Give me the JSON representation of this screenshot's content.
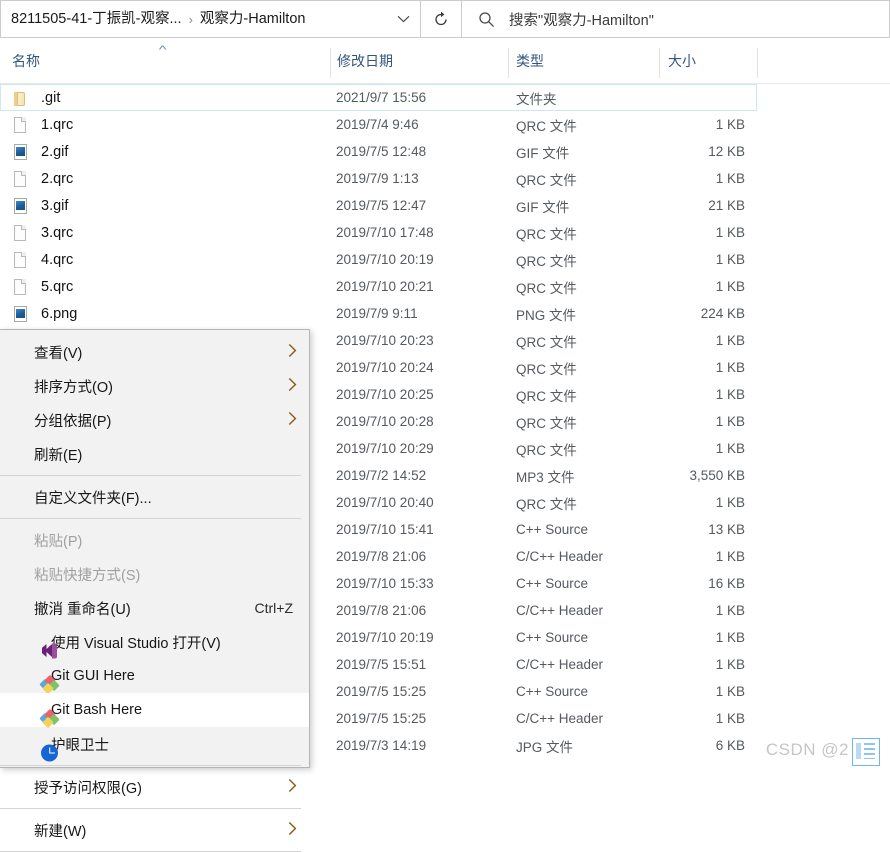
{
  "addressbar": {
    "crumb_parent": "8211505-41-丁振凯-观察...",
    "crumb_separator": "›",
    "crumb_current": "观察力-Hamilton",
    "dropdown_icon": "chevron-down-icon",
    "refresh_icon": "refresh-icon"
  },
  "search": {
    "icon": "search-icon",
    "placeholder": "搜索\"观察力-Hamilton\""
  },
  "columns": {
    "name": "名称",
    "date": "修改日期",
    "type": "类型",
    "size": "大小",
    "sort_indicator": "^"
  },
  "files": [
    {
      "name": ".git",
      "icon": "folder-icon",
      "date": "2021/9/7 15:56",
      "type": "文件夹",
      "size": "",
      "selected": true
    },
    {
      "name": "1.qrc",
      "icon": "document-icon",
      "date": "2019/7/4 9:46",
      "type": "QRC 文件",
      "size": "1 KB",
      "selected": false
    },
    {
      "name": "2.gif",
      "icon": "image-icon",
      "date": "2019/7/5 12:48",
      "type": "GIF 文件",
      "size": "12 KB",
      "selected": false
    },
    {
      "name": "2.qrc",
      "icon": "document-icon",
      "date": "2019/7/9 1:13",
      "type": "QRC 文件",
      "size": "1 KB",
      "selected": false
    },
    {
      "name": "3.gif",
      "icon": "image-icon",
      "date": "2019/7/5 12:47",
      "type": "GIF 文件",
      "size": "21 KB",
      "selected": false
    },
    {
      "name": "3.qrc",
      "icon": "document-icon",
      "date": "2019/7/10 17:48",
      "type": "QRC 文件",
      "size": "1 KB",
      "selected": false
    },
    {
      "name": "4.qrc",
      "icon": "document-icon",
      "date": "2019/7/10 20:19",
      "type": "QRC 文件",
      "size": "1 KB",
      "selected": false
    },
    {
      "name": "5.qrc",
      "icon": "document-icon",
      "date": "2019/7/10 20:21",
      "type": "QRC 文件",
      "size": "1 KB",
      "selected": false
    },
    {
      "name": "6.png",
      "icon": "image-icon",
      "date": "2019/7/9 9:11",
      "type": "PNG 文件",
      "size": "224 KB",
      "selected": false
    },
    {
      "name": "",
      "icon": "",
      "date": "2019/7/10 20:23",
      "type": "QRC 文件",
      "size": "1 KB",
      "selected": false
    },
    {
      "name": "",
      "icon": "",
      "date": "2019/7/10 20:24",
      "type": "QRC 文件",
      "size": "1 KB",
      "selected": false
    },
    {
      "name": "",
      "icon": "",
      "date": "2019/7/10 20:25",
      "type": "QRC 文件",
      "size": "1 KB",
      "selected": false
    },
    {
      "name": "",
      "icon": "",
      "date": "2019/7/10 20:28",
      "type": "QRC 文件",
      "size": "1 KB",
      "selected": false
    },
    {
      "name": "",
      "icon": "",
      "date": "2019/7/10 20:29",
      "type": "QRC 文件",
      "size": "1 KB",
      "selected": false
    },
    {
      "name": "",
      "icon": "",
      "date": "2019/7/2 14:52",
      "type": "MP3 文件",
      "size": "3,550 KB",
      "selected": false
    },
    {
      "name": "",
      "icon": "",
      "date": "2019/7/10 20:40",
      "type": "QRC 文件",
      "size": "1 KB",
      "selected": false
    },
    {
      "name": "",
      "icon": "",
      "date": "2019/7/10 15:41",
      "type": "C++ Source",
      "size": "13 KB",
      "selected": false
    },
    {
      "name": "",
      "icon": "",
      "date": "2019/7/8 21:06",
      "type": "C/C++ Header",
      "size": "1 KB",
      "selected": false
    },
    {
      "name": "",
      "icon": "",
      "date": "2019/7/10 15:33",
      "type": "C++ Source",
      "size": "16 KB",
      "selected": false
    },
    {
      "name": "",
      "icon": "",
      "date": "2019/7/8 21:06",
      "type": "C/C++ Header",
      "size": "1 KB",
      "selected": false
    },
    {
      "name": "",
      "icon": "",
      "date": "2019/7/10 20:19",
      "type": "C++ Source",
      "size": "1 KB",
      "selected": false
    },
    {
      "name": "",
      "icon": "",
      "date": "2019/7/5 15:51",
      "type": "C/C++ Header",
      "size": "1 KB",
      "selected": false
    },
    {
      "name": "",
      "icon": "",
      "date": "2019/7/5 15:25",
      "type": "C++ Source",
      "size": "1 KB",
      "selected": false
    },
    {
      "name": "",
      "icon": "",
      "date": "2019/7/5 15:25",
      "type": "C/C++ Header",
      "size": "1 KB",
      "selected": false
    },
    {
      "name": "",
      "icon": "",
      "date": "2019/7/3 14:19",
      "type": "JPG 文件",
      "size": "6 KB",
      "selected": false
    }
  ],
  "context_menu": [
    {
      "kind": "item",
      "label": "查看(V)",
      "icon": "",
      "accel": "",
      "submenu": true,
      "disabled": false,
      "highlighted": false
    },
    {
      "kind": "item",
      "label": "排序方式(O)",
      "icon": "",
      "accel": "",
      "submenu": true,
      "disabled": false,
      "highlighted": false
    },
    {
      "kind": "item",
      "label": "分组依据(P)",
      "icon": "",
      "accel": "",
      "submenu": true,
      "disabled": false,
      "highlighted": false
    },
    {
      "kind": "item",
      "label": "刷新(E)",
      "icon": "",
      "accel": "",
      "submenu": false,
      "disabled": false,
      "highlighted": false
    },
    {
      "kind": "separator"
    },
    {
      "kind": "item",
      "label": "自定义文件夹(F)...",
      "icon": "",
      "accel": "",
      "submenu": false,
      "disabled": false,
      "highlighted": false
    },
    {
      "kind": "separator"
    },
    {
      "kind": "item",
      "label": "粘贴(P)",
      "icon": "",
      "accel": "",
      "submenu": false,
      "disabled": true,
      "highlighted": false
    },
    {
      "kind": "item",
      "label": "粘贴快捷方式(S)",
      "icon": "",
      "accel": "",
      "submenu": false,
      "disabled": true,
      "highlighted": false
    },
    {
      "kind": "item",
      "label": "撤消 重命名(U)",
      "icon": "",
      "accel": "Ctrl+Z",
      "submenu": false,
      "disabled": false,
      "highlighted": false
    },
    {
      "kind": "item",
      "label": "使用 Visual Studio 打开(V)",
      "icon": "visual-studio-icon",
      "accel": "",
      "submenu": false,
      "disabled": false,
      "highlighted": false
    },
    {
      "kind": "item",
      "label": "Git GUI Here",
      "icon": "git-icon",
      "accel": "",
      "submenu": false,
      "disabled": false,
      "highlighted": false
    },
    {
      "kind": "item",
      "label": "Git Bash Here",
      "icon": "git-icon",
      "accel": "",
      "submenu": false,
      "disabled": false,
      "highlighted": true
    },
    {
      "kind": "item",
      "label": "护眼卫士",
      "icon": "eye-care-icon",
      "accel": "",
      "submenu": false,
      "disabled": false,
      "highlighted": false
    },
    {
      "kind": "separator"
    },
    {
      "kind": "item",
      "label": "授予访问权限(G)",
      "icon": "",
      "accel": "",
      "submenu": true,
      "disabled": false,
      "highlighted": false
    },
    {
      "kind": "separator"
    },
    {
      "kind": "item",
      "label": "新建(W)",
      "icon": "",
      "accel": "",
      "submenu": true,
      "disabled": false,
      "highlighted": false
    },
    {
      "kind": "separator"
    }
  ],
  "watermark": {
    "text": "CSDN @2",
    "icon": "document-list-icon"
  }
}
